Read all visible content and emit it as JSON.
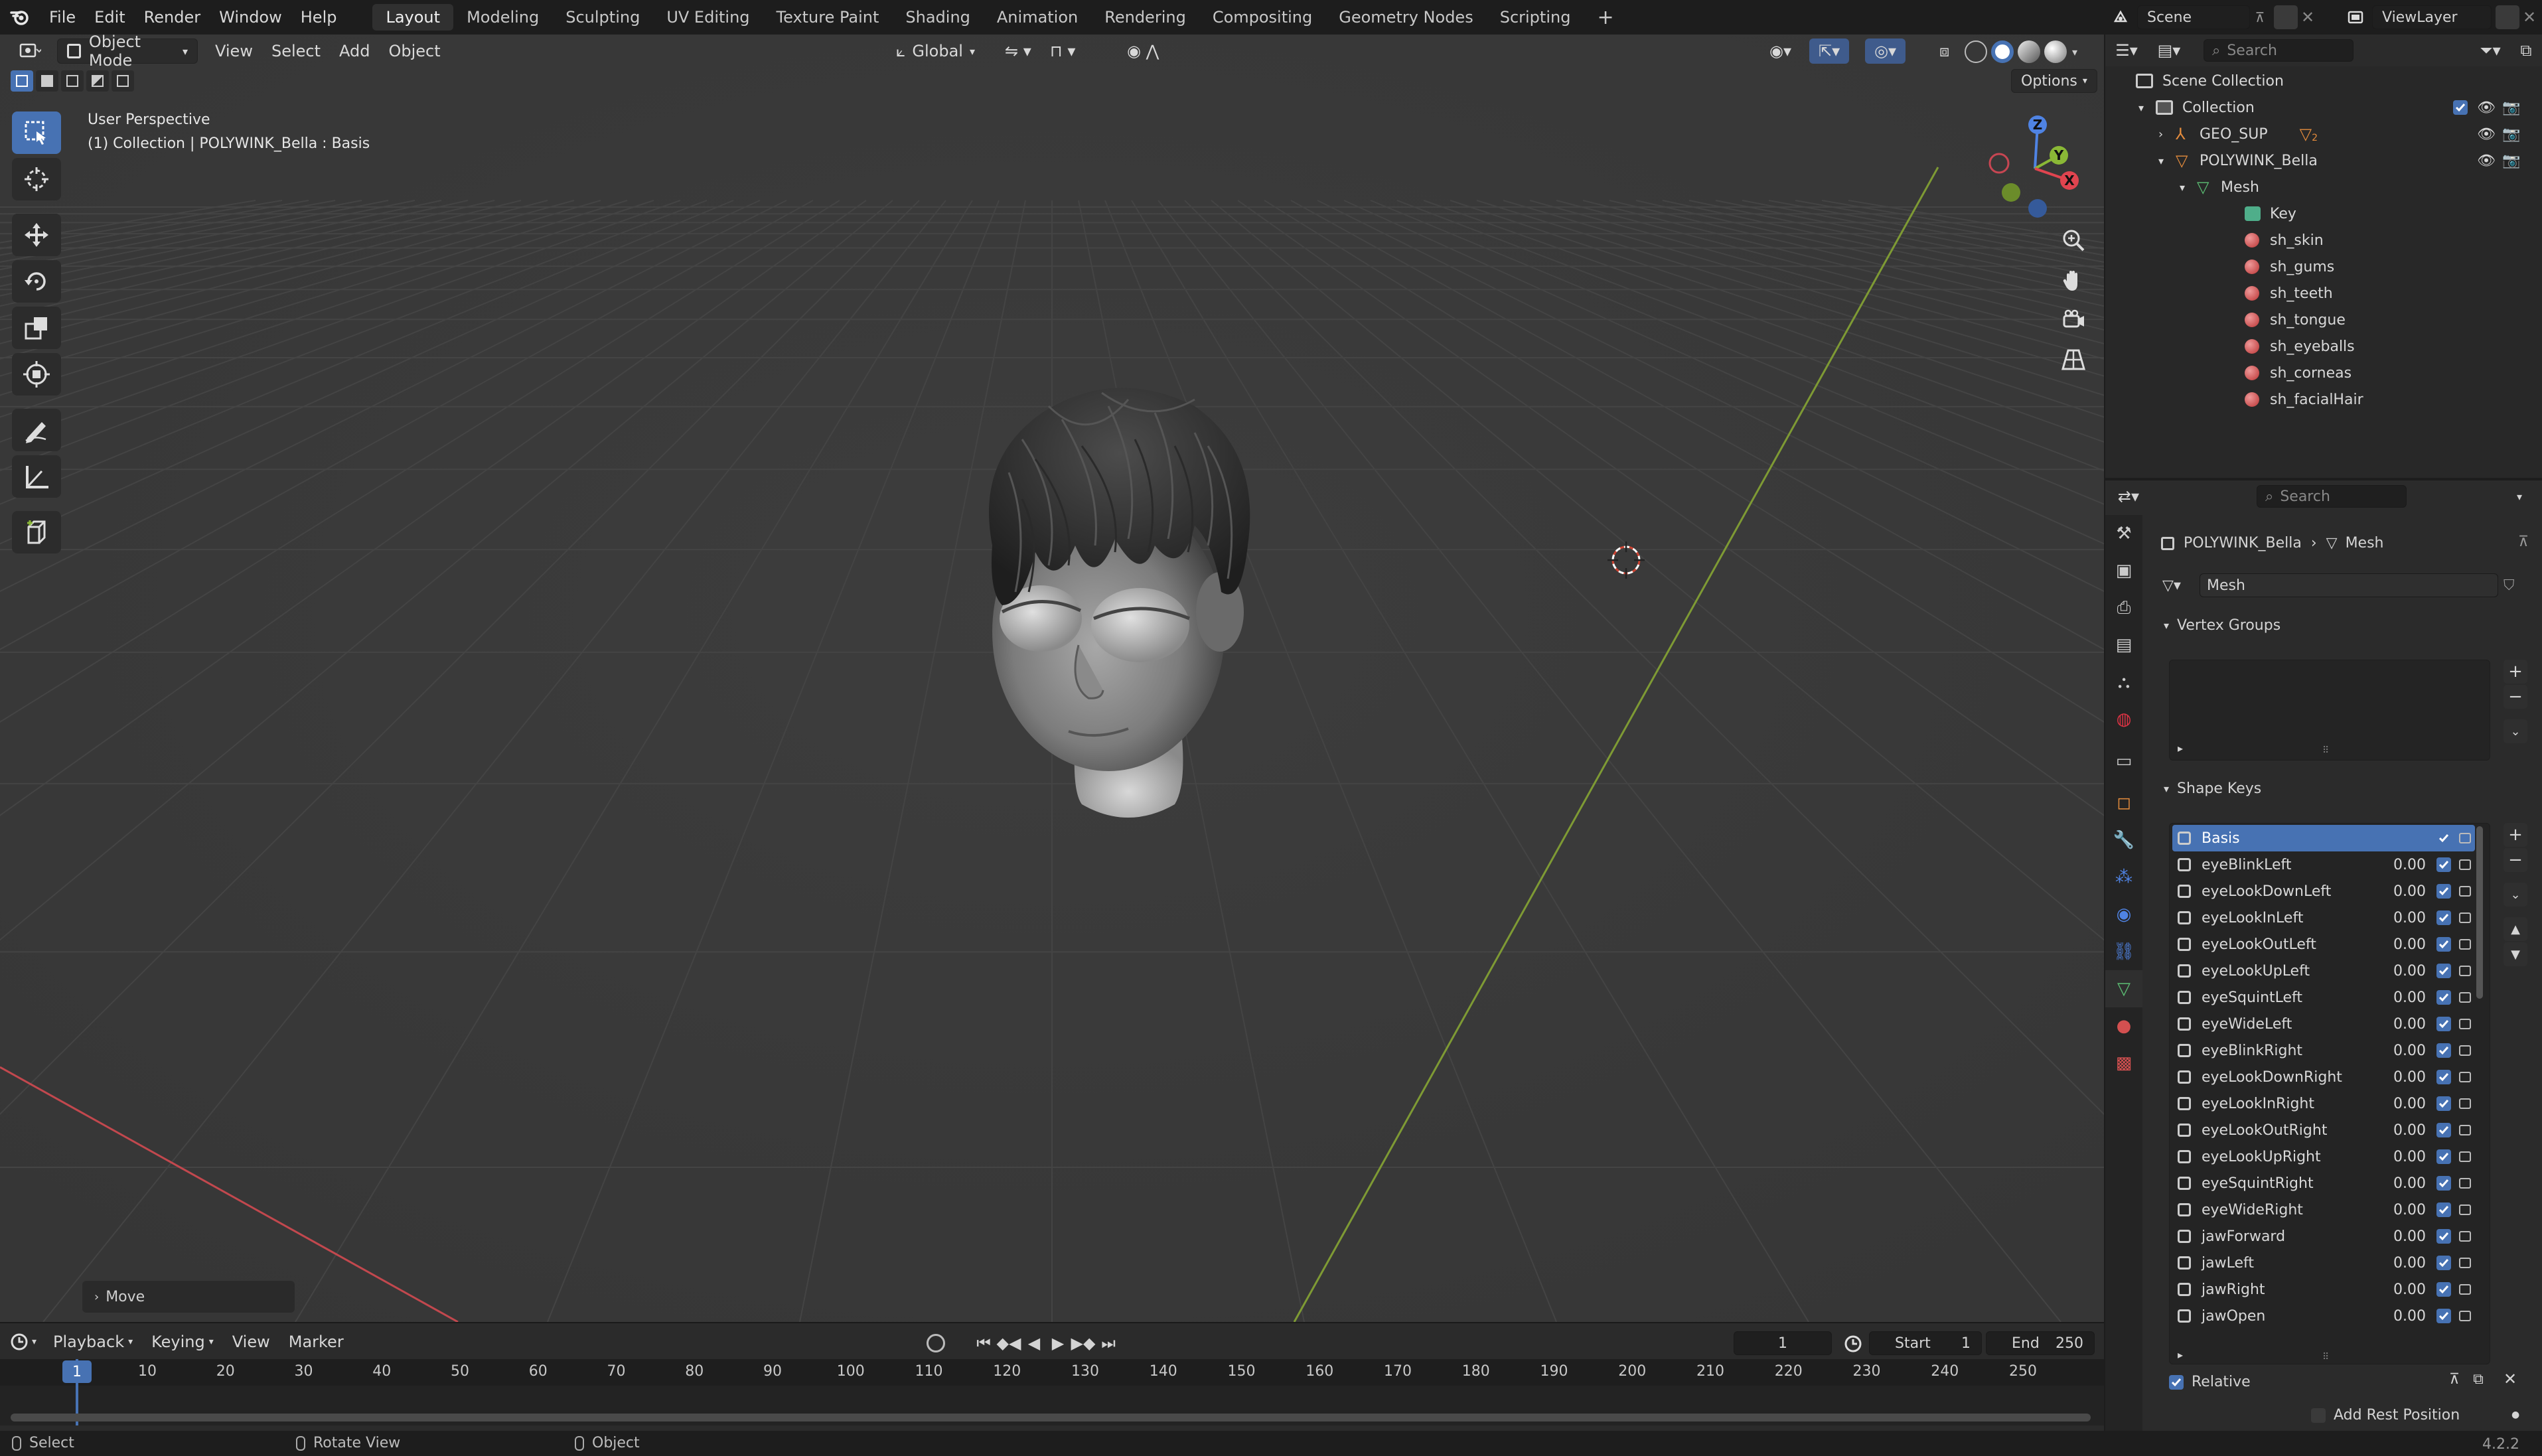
{
  "top_menu": {
    "items": [
      "File",
      "Edit",
      "Render",
      "Window",
      "Help"
    ],
    "workspaces": [
      "Layout",
      "Modeling",
      "Sculpting",
      "UV Editing",
      "Texture Paint",
      "Shading",
      "Animation",
      "Rendering",
      "Compositing",
      "Geometry Nodes",
      "Scripting"
    ],
    "add_tab": "+",
    "scene_name": "Scene",
    "view_layer_name": "ViewLayer"
  },
  "viewport": {
    "mode": "Object Mode",
    "menus": [
      "View",
      "Select",
      "Add",
      "Object"
    ],
    "orientation": "Global",
    "options_label": "Options",
    "perspective_label": "User Perspective",
    "context_label": "(1) Collection | POLYWINK_Bella : Basis",
    "last_op": "Move",
    "gizmo_labels": {
      "x": "X",
      "y": "Y",
      "z": "Z"
    }
  },
  "outliner": {
    "search_placeholder": "Search",
    "scene_collection": "Scene Collection",
    "collection": "Collection",
    "items": [
      {
        "label": "GEO_SUP",
        "badge": "2"
      },
      {
        "label": "POLYWINK_Bella"
      },
      {
        "label": "Mesh"
      },
      {
        "label": "Key"
      },
      {
        "label": "sh_skin"
      },
      {
        "label": "sh_gums"
      },
      {
        "label": "sh_teeth"
      },
      {
        "label": "sh_tongue"
      },
      {
        "label": "sh_eyeballs"
      },
      {
        "label": "sh_corneas"
      },
      {
        "label": "sh_facialHair"
      }
    ]
  },
  "properties": {
    "search_placeholder": "Search",
    "breadcrumb": {
      "object": "POLYWINK_Bella",
      "data": "Mesh"
    },
    "mesh_name": "Mesh",
    "vertex_groups_title": "Vertex Groups",
    "shape_keys_title": "Shape Keys",
    "shape_keys": [
      {
        "name": "Basis",
        "value": ""
      },
      {
        "name": "eyeBlinkLeft",
        "value": "0.00"
      },
      {
        "name": "eyeLookDownLeft",
        "value": "0.00"
      },
      {
        "name": "eyeLookInLeft",
        "value": "0.00"
      },
      {
        "name": "eyeLookOutLeft",
        "value": "0.00"
      },
      {
        "name": "eyeLookUpLeft",
        "value": "0.00"
      },
      {
        "name": "eyeSquintLeft",
        "value": "0.00"
      },
      {
        "name": "eyeWideLeft",
        "value": "0.00"
      },
      {
        "name": "eyeBlinkRight",
        "value": "0.00"
      },
      {
        "name": "eyeLookDownRight",
        "value": "0.00"
      },
      {
        "name": "eyeLookInRight",
        "value": "0.00"
      },
      {
        "name": "eyeLookOutRight",
        "value": "0.00"
      },
      {
        "name": "eyeLookUpRight",
        "value": "0.00"
      },
      {
        "name": "eyeSquintRight",
        "value": "0.00"
      },
      {
        "name": "eyeWideRight",
        "value": "0.00"
      },
      {
        "name": "jawForward",
        "value": "0.00"
      },
      {
        "name": "jawLeft",
        "value": "0.00"
      },
      {
        "name": "jawRight",
        "value": "0.00"
      },
      {
        "name": "jawOpen",
        "value": "0.00"
      }
    ],
    "relative_label": "Relative",
    "add_rest_label": "Add Rest Position"
  },
  "timeline": {
    "menus": [
      "Playback",
      "Keying",
      "View",
      "Marker"
    ],
    "current_frame": "1",
    "start_label": "Start",
    "start_value": "1",
    "end_label": "End",
    "end_value": "250",
    "ruler": [
      "1",
      "10",
      "20",
      "30",
      "40",
      "50",
      "60",
      "70",
      "80",
      "90",
      "100",
      "110",
      "120",
      "130",
      "140",
      "150",
      "160",
      "170",
      "180",
      "190",
      "200",
      "210",
      "220",
      "230",
      "240",
      "250"
    ]
  },
  "status_bar": {
    "select": "Select",
    "rotate": "Rotate View",
    "object": "Object",
    "version": "4.2.2"
  },
  "colors": {
    "accent": "#4772b3",
    "x_axis": "#e0444f",
    "y_axis": "#8ab836",
    "z_axis": "#4f83e3"
  }
}
